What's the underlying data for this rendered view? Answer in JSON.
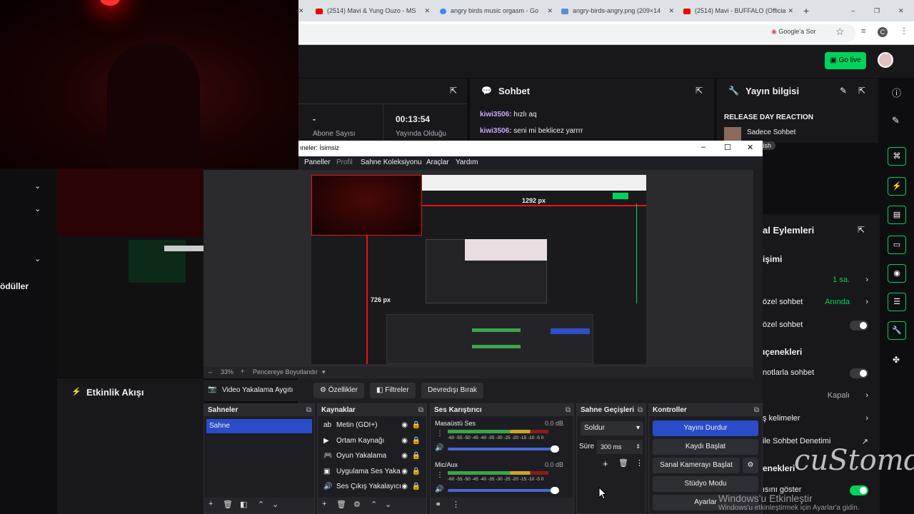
{
  "browser": {
    "tabs": [
      {
        "label": "(2514) Mavi & Yung Ouzo - MS",
        "favicon": "youtube-icon"
      },
      {
        "label": "angry birds music orgasm - Go",
        "favicon": "google-icon"
      },
      {
        "label": "angry-birds-angry.png (209×14",
        "favicon": "gif-icon"
      },
      {
        "label": "(2514) Mavi - BUFFALO (Officia",
        "favicon": "youtube-icon"
      }
    ],
    "google_lens": "Google'a Sor",
    "profile_letter": "C"
  },
  "twitch": {
    "go_live": "Go live",
    "stats": {
      "dash": "-",
      "subscribers_label": "Abone Sayısı",
      "uptime": "00:13:54",
      "uptime_label": "Yayında Olduğu"
    },
    "chat": {
      "title": "Sohbet",
      "messages": [
        {
          "user": "kiwi3506:",
          "text": "hızlı aq"
        },
        {
          "user": "kiwi3506:",
          "text": "seni mi beklicez yarrrr"
        }
      ]
    },
    "stream_info": {
      "title": "Yayın bilgisi",
      "stream_title": "RELEASE DAY REACTION",
      "category": "Sadece Sohbet",
      "tag": "kish"
    },
    "left": {
      "rewards": "ödüller"
    },
    "activity_feed": "Etkinlik Akışı",
    "actions": {
      "title": "al Eylemleri",
      "section1": "işimi",
      "row1_value": "1 sa.",
      "row2_label": "özel sohbet",
      "row2_value": "Anında",
      "row3_label": "özel sohbet",
      "section2": "ıçenekleri",
      "row4_label": "notlarla sohbet",
      "row5_value": "Kapalı",
      "row6_label": "ş kelimeler",
      "row7_label": "ile Sohbet Denetimi",
      "section3": "enekleri",
      "row8_label": "ısını göster"
    }
  },
  "obs": {
    "title": "ıneler: İsimsiz",
    "menu": [
      "Paneller",
      "Profil",
      "Sahne Koleksiyonu",
      "Araçlar",
      "Yardım"
    ],
    "preview_width_label": "1292 px",
    "preview_height_label": "726 px",
    "zoom": "33%",
    "zoom_mode": "Pencereye Boyutlandır",
    "context": {
      "source": "Video Yakalama Aygıtı",
      "properties": "Özellikler",
      "filters": "Filtreler",
      "deactivate": "Devredışı Bırak"
    },
    "scenes": {
      "title": "Sahneler",
      "items": [
        "Sahne"
      ]
    },
    "sources": {
      "title": "Kaynaklar",
      "items": [
        {
          "name": "Metin (GDI+)",
          "icon": "text-icon"
        },
        {
          "name": "Ortam Kaynağı",
          "icon": "play-icon"
        },
        {
          "name": "Oyun Yakalama",
          "icon": "gamepad-icon"
        },
        {
          "name": "Uygulama Ses Yaka",
          "icon": "app-audio-icon"
        },
        {
          "name": "Ses Çıkış Yakalayıcı",
          "icon": "speaker-icon"
        }
      ]
    },
    "mixer": {
      "title": "Ses Karıştırıcı",
      "channels": [
        {
          "name": "Masaüstü Ses",
          "db": "0.0 dB",
          "level": 0.86
        },
        {
          "name": "Mic/Aux",
          "db": "0.0 dB",
          "level": 0.86
        }
      ],
      "scale": [
        "-60",
        "-55",
        "-50",
        "-45",
        "-40",
        "-35",
        "-30",
        "-25",
        "-20",
        "-15",
        "-10",
        "-5",
        "0"
      ]
    },
    "transitions": {
      "title": "Sahne Geçişleri",
      "type": "Soldur",
      "duration_label": "Süre",
      "duration": "300 ms"
    },
    "controls": {
      "title": "Kontroller",
      "buttons": [
        "Yayını Durdur",
        "Kaydı Başlat",
        "Sanal Kamerayı Başlat",
        "Stüdyo Modu",
        "Ayarlar"
      ]
    }
  },
  "watermark": {
    "line1": "Windows'u Etkinleştir",
    "line2": "Windows'u etkinleştirmek için Ayarlar'a gidin."
  },
  "brand": "cuStomd",
  "colors": {
    "twitch_green": "#00d35b",
    "obs_blue": "#2b4cc8",
    "accent_red": "#e11"
  }
}
